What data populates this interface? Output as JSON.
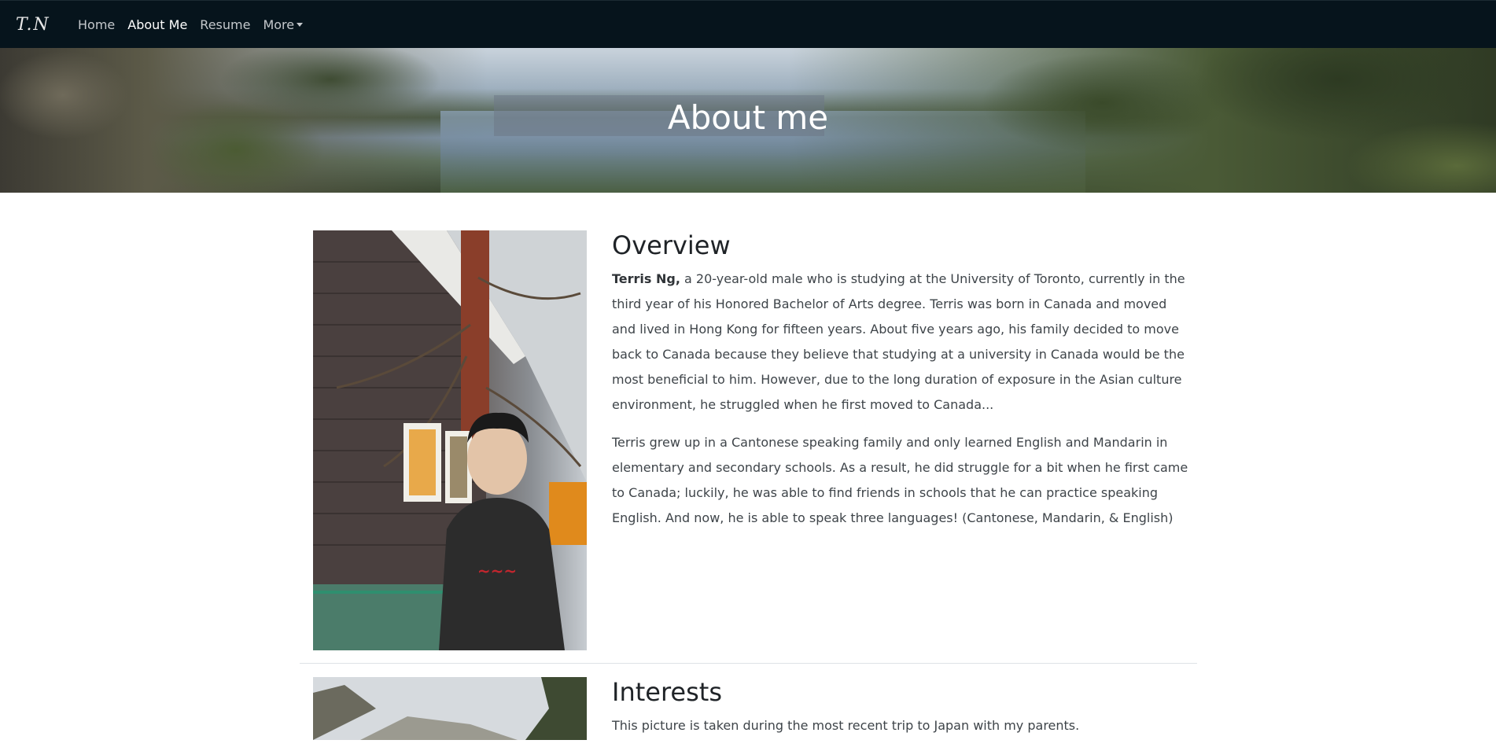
{
  "nav": {
    "brand": "T.N",
    "items": [
      {
        "label": "Home",
        "active": false
      },
      {
        "label": "About Me",
        "active": true
      },
      {
        "label": "Resume",
        "active": false
      },
      {
        "label": "More",
        "active": false,
        "dropdown": true
      }
    ]
  },
  "hero": {
    "title": "About me"
  },
  "overview": {
    "heading": "Overview",
    "para1_lead": "Terris Ng,",
    "para1_text": " a 20-year-old male who is studying at the University of Toronto, currently in the third year of his Honored Bachelor of Arts degree. Terris was born in Canada and moved and lived in Hong Kong for fifteen years. About five years ago, his family decided to move back to Canada because they believe that studying at a university in Canada would be the most beneficial to him. However, due to the long duration of exposure in the Asian culture environment, he struggled when he first moved to Canada...",
    "para2": "Terris grew up in a Cantonese speaking family and only learned English and Mandarin in elementary and secondary schools. As a result, he did struggle for a bit when he first came to Canada; luckily, he was able to find friends in schools that he can practice speaking English. And now, he is able to speak three languages! (Cantonese, Mandarin, & English)"
  },
  "interests": {
    "heading": "Interests",
    "para1": "This picture is taken during the most recent trip to Japan with my parents."
  },
  "colors": {
    "navbar_bg": "#06141c",
    "nav_active": "#ffffff",
    "nav_inactive": "#c4c8cc"
  }
}
